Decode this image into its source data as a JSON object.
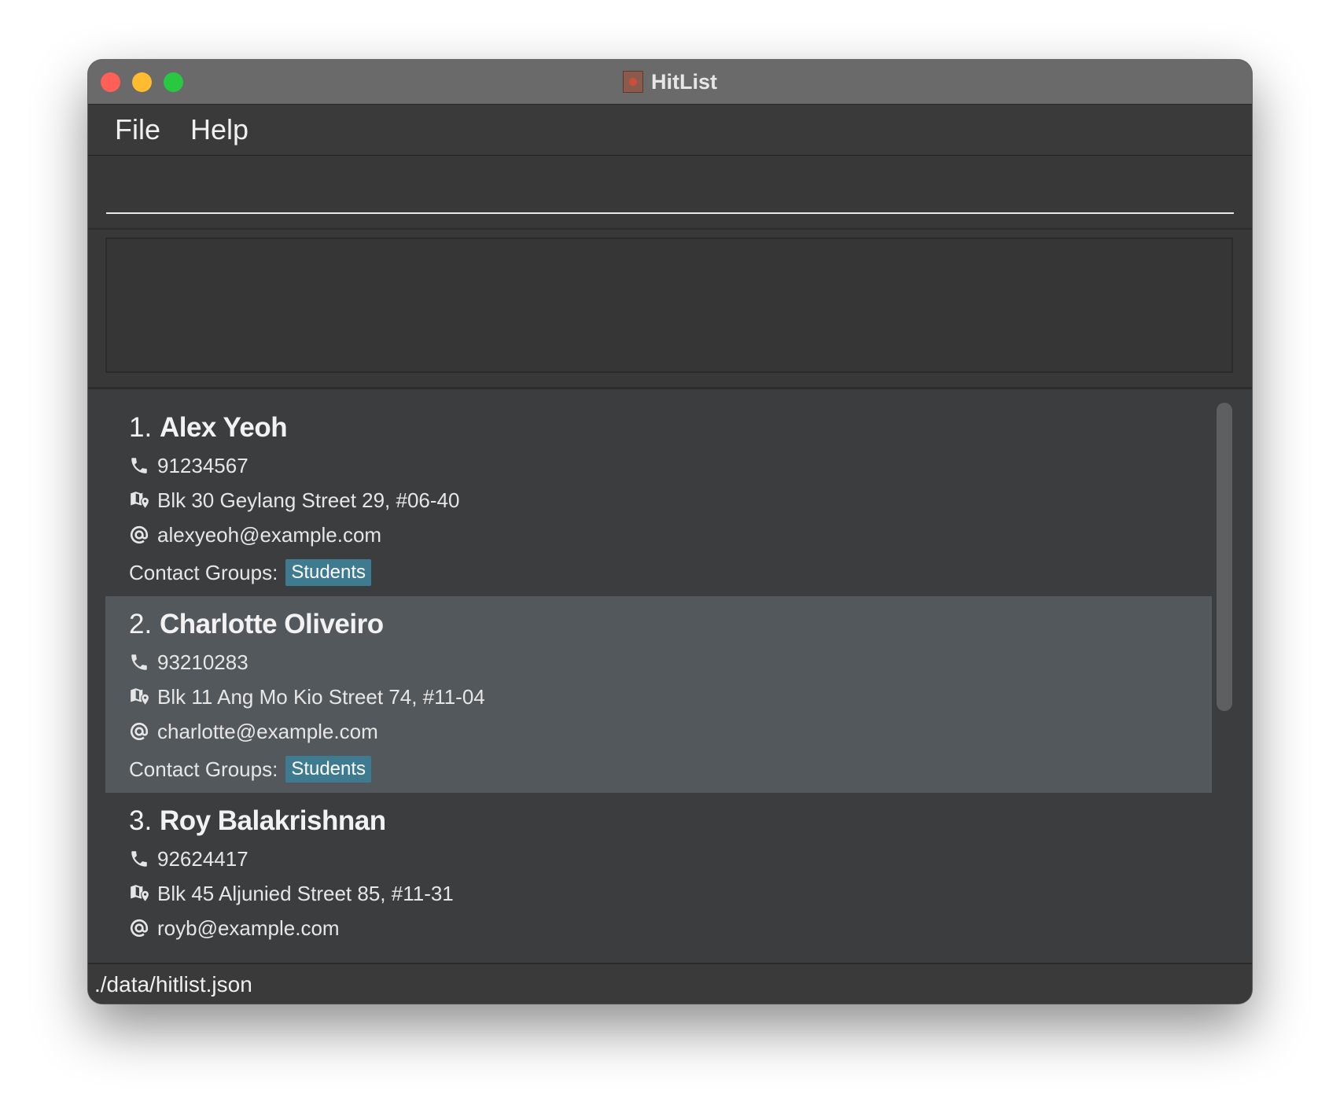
{
  "window": {
    "title": "HitList",
    "icon": "hitlist-app-icon"
  },
  "menu": {
    "items": [
      "File",
      "Help"
    ]
  },
  "command": {
    "value": "",
    "placeholder": ""
  },
  "result": {
    "text": ""
  },
  "contacts": [
    {
      "index": "1.",
      "name": "Alex Yeoh",
      "phone": "91234567",
      "address": "Blk 30 Geylang Street 29, #06-40",
      "email": "alexyeoh@example.com",
      "groups_label": "Contact Groups:",
      "groups": [
        "Students"
      ],
      "selected": false
    },
    {
      "index": "2.",
      "name": "Charlotte Oliveiro",
      "phone": "93210283",
      "address": "Blk 11 Ang Mo Kio Street 74, #11-04",
      "email": "charlotte@example.com",
      "groups_label": "Contact Groups:",
      "groups": [
        "Students"
      ],
      "selected": true
    },
    {
      "index": "3.",
      "name": "Roy Balakrishnan",
      "phone": "92624417",
      "address": "Blk 45 Aljunied Street 85, #11-31",
      "email": "royb@example.com",
      "groups_label": "",
      "groups": [],
      "selected": false
    }
  ],
  "icons": {
    "phone": "phone-icon",
    "address": "map-pin-icon",
    "email": "at-sign-icon"
  },
  "colors": {
    "window_bg": "#3b3c3e",
    "titlebar": "#6a6a6b",
    "selected_row": "#53585c",
    "tag_bg": "#3e7b91",
    "close": "#fe5f57",
    "minimize": "#febc2e",
    "maximize": "#28c840"
  },
  "status": {
    "path": "./data/hitlist.json"
  }
}
